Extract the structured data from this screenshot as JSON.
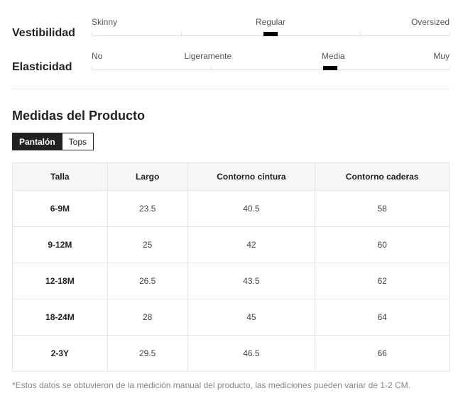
{
  "fit": {
    "label": "Vestibilidad",
    "scale": [
      "Skinny",
      "Regular",
      "Oversized"
    ],
    "selected": "Regular"
  },
  "elasticity": {
    "label": "Elasticidad",
    "scale": [
      "No",
      "Ligeramente",
      "Media",
      "Muy"
    ],
    "selected": "Media"
  },
  "measurements": {
    "title": "Medidas del Producto",
    "tabs": [
      {
        "label": "Pantalón",
        "active": true
      },
      {
        "label": "Tops",
        "active": false
      }
    ],
    "columns": [
      "Talla",
      "Largo",
      "Contorno cintura",
      "Contorno caderas"
    ],
    "rows": [
      {
        "size": "6-9M",
        "length": "23.5",
        "waist": "40.5",
        "hip": "58"
      },
      {
        "size": "9-12M",
        "length": "25",
        "waist": "42",
        "hip": "60"
      },
      {
        "size": "12-18M",
        "length": "26.5",
        "waist": "43.5",
        "hip": "62"
      },
      {
        "size": "18-24M",
        "length": "28",
        "waist": "45",
        "hip": "64"
      },
      {
        "size": "2-3Y",
        "length": "29.5",
        "waist": "46.5",
        "hip": "66"
      }
    ]
  },
  "footnote": "*Estos datos se obtuvieron de la medición manual del producto, las mediciones pueden variar de 1-2 CM.",
  "colors": {
    "active_tab_bg": "#222222",
    "marker": "#000000",
    "header_bg": "#f6f6f6",
    "border": "#e5e5e5"
  }
}
